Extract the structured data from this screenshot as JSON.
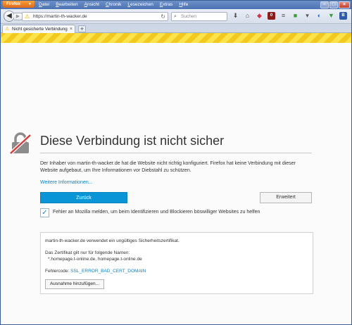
{
  "browser": {
    "app_button": "Firefox",
    "menu": [
      "Datei",
      "Bearbeiten",
      "Ansicht",
      "Chronik",
      "Lesezeichen",
      "Extras",
      "Hilfe"
    ],
    "url": "https://martin-th-wacker.de",
    "search_placeholder": "Suchen",
    "tab_title": "Nicht gesicherte Verbindung",
    "toolbar_icons": [
      "download-icon",
      "home-icon",
      "pocket-icon",
      "ublock-icon",
      "menu-icon",
      "addon-green-icon",
      "addon-blue-icon",
      "bookmark-icon",
      "shield-addon-icon",
      "settings-icon"
    ]
  },
  "error_page": {
    "title": "Diese Verbindung ist nicht sicher",
    "description": "Der Inhaber von martin-th-wacker.de hat die Website nicht richtig konfiguriert. Firefox hat keine Verbindung mit dieser Website aufgebaut, um Ihre Informationen vor Diebstahl zu schützen.",
    "more_info_link": "Weitere Informationen...",
    "back_button": "Zurück",
    "advanced_button": "Erweitert",
    "report_checkbox_label": "Fehler an Mozilla melden, um beim Identifizieren und Blockieren böswilliger Websites zu helfen",
    "report_checked": true,
    "details": {
      "line1": "martin-th-wacker.de verwendet ein ungültiges Sicherheitszertifikat.",
      "line2": "Das Zertifikat gilt nur für folgende Namen:",
      "line3": "*.homepage.t-online.de, homepage.t-online.de",
      "error_code_label": "Fehlercode:",
      "error_code": "SSL_ERROR_BAD_CERT_DOMAIN",
      "exception_button": "Ausnahme hinzufügen..."
    }
  },
  "colors": {
    "accent": "#0a96d6",
    "link": "#0a84c4",
    "warning_stripe": "#fce34a"
  }
}
